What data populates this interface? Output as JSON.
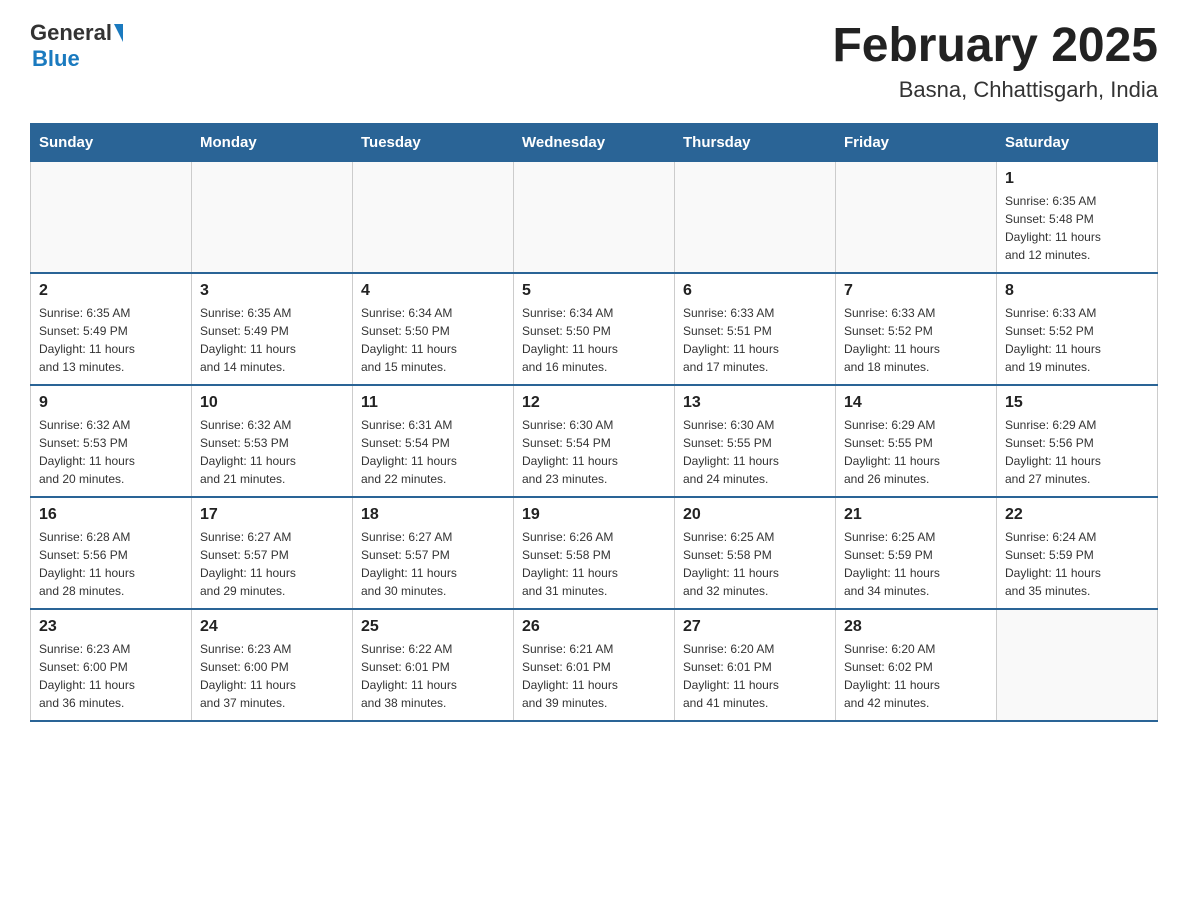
{
  "header": {
    "logo_general": "General",
    "logo_blue": "Blue",
    "month_title": "February 2025",
    "location": "Basna, Chhattisgarh, India"
  },
  "weekdays": [
    "Sunday",
    "Monday",
    "Tuesday",
    "Wednesday",
    "Thursday",
    "Friday",
    "Saturday"
  ],
  "weeks": [
    [
      {
        "day": "",
        "info": ""
      },
      {
        "day": "",
        "info": ""
      },
      {
        "day": "",
        "info": ""
      },
      {
        "day": "",
        "info": ""
      },
      {
        "day": "",
        "info": ""
      },
      {
        "day": "",
        "info": ""
      },
      {
        "day": "1",
        "info": "Sunrise: 6:35 AM\nSunset: 5:48 PM\nDaylight: 11 hours\nand 12 minutes."
      }
    ],
    [
      {
        "day": "2",
        "info": "Sunrise: 6:35 AM\nSunset: 5:49 PM\nDaylight: 11 hours\nand 13 minutes."
      },
      {
        "day": "3",
        "info": "Sunrise: 6:35 AM\nSunset: 5:49 PM\nDaylight: 11 hours\nand 14 minutes."
      },
      {
        "day": "4",
        "info": "Sunrise: 6:34 AM\nSunset: 5:50 PM\nDaylight: 11 hours\nand 15 minutes."
      },
      {
        "day": "5",
        "info": "Sunrise: 6:34 AM\nSunset: 5:50 PM\nDaylight: 11 hours\nand 16 minutes."
      },
      {
        "day": "6",
        "info": "Sunrise: 6:33 AM\nSunset: 5:51 PM\nDaylight: 11 hours\nand 17 minutes."
      },
      {
        "day": "7",
        "info": "Sunrise: 6:33 AM\nSunset: 5:52 PM\nDaylight: 11 hours\nand 18 minutes."
      },
      {
        "day": "8",
        "info": "Sunrise: 6:33 AM\nSunset: 5:52 PM\nDaylight: 11 hours\nand 19 minutes."
      }
    ],
    [
      {
        "day": "9",
        "info": "Sunrise: 6:32 AM\nSunset: 5:53 PM\nDaylight: 11 hours\nand 20 minutes."
      },
      {
        "day": "10",
        "info": "Sunrise: 6:32 AM\nSunset: 5:53 PM\nDaylight: 11 hours\nand 21 minutes."
      },
      {
        "day": "11",
        "info": "Sunrise: 6:31 AM\nSunset: 5:54 PM\nDaylight: 11 hours\nand 22 minutes."
      },
      {
        "day": "12",
        "info": "Sunrise: 6:30 AM\nSunset: 5:54 PM\nDaylight: 11 hours\nand 23 minutes."
      },
      {
        "day": "13",
        "info": "Sunrise: 6:30 AM\nSunset: 5:55 PM\nDaylight: 11 hours\nand 24 minutes."
      },
      {
        "day": "14",
        "info": "Sunrise: 6:29 AM\nSunset: 5:55 PM\nDaylight: 11 hours\nand 26 minutes."
      },
      {
        "day": "15",
        "info": "Sunrise: 6:29 AM\nSunset: 5:56 PM\nDaylight: 11 hours\nand 27 minutes."
      }
    ],
    [
      {
        "day": "16",
        "info": "Sunrise: 6:28 AM\nSunset: 5:56 PM\nDaylight: 11 hours\nand 28 minutes."
      },
      {
        "day": "17",
        "info": "Sunrise: 6:27 AM\nSunset: 5:57 PM\nDaylight: 11 hours\nand 29 minutes."
      },
      {
        "day": "18",
        "info": "Sunrise: 6:27 AM\nSunset: 5:57 PM\nDaylight: 11 hours\nand 30 minutes."
      },
      {
        "day": "19",
        "info": "Sunrise: 6:26 AM\nSunset: 5:58 PM\nDaylight: 11 hours\nand 31 minutes."
      },
      {
        "day": "20",
        "info": "Sunrise: 6:25 AM\nSunset: 5:58 PM\nDaylight: 11 hours\nand 32 minutes."
      },
      {
        "day": "21",
        "info": "Sunrise: 6:25 AM\nSunset: 5:59 PM\nDaylight: 11 hours\nand 34 minutes."
      },
      {
        "day": "22",
        "info": "Sunrise: 6:24 AM\nSunset: 5:59 PM\nDaylight: 11 hours\nand 35 minutes."
      }
    ],
    [
      {
        "day": "23",
        "info": "Sunrise: 6:23 AM\nSunset: 6:00 PM\nDaylight: 11 hours\nand 36 minutes."
      },
      {
        "day": "24",
        "info": "Sunrise: 6:23 AM\nSunset: 6:00 PM\nDaylight: 11 hours\nand 37 minutes."
      },
      {
        "day": "25",
        "info": "Sunrise: 6:22 AM\nSunset: 6:01 PM\nDaylight: 11 hours\nand 38 minutes."
      },
      {
        "day": "26",
        "info": "Sunrise: 6:21 AM\nSunset: 6:01 PM\nDaylight: 11 hours\nand 39 minutes."
      },
      {
        "day": "27",
        "info": "Sunrise: 6:20 AM\nSunset: 6:01 PM\nDaylight: 11 hours\nand 41 minutes."
      },
      {
        "day": "28",
        "info": "Sunrise: 6:20 AM\nSunset: 6:02 PM\nDaylight: 11 hours\nand 42 minutes."
      },
      {
        "day": "",
        "info": ""
      }
    ]
  ]
}
